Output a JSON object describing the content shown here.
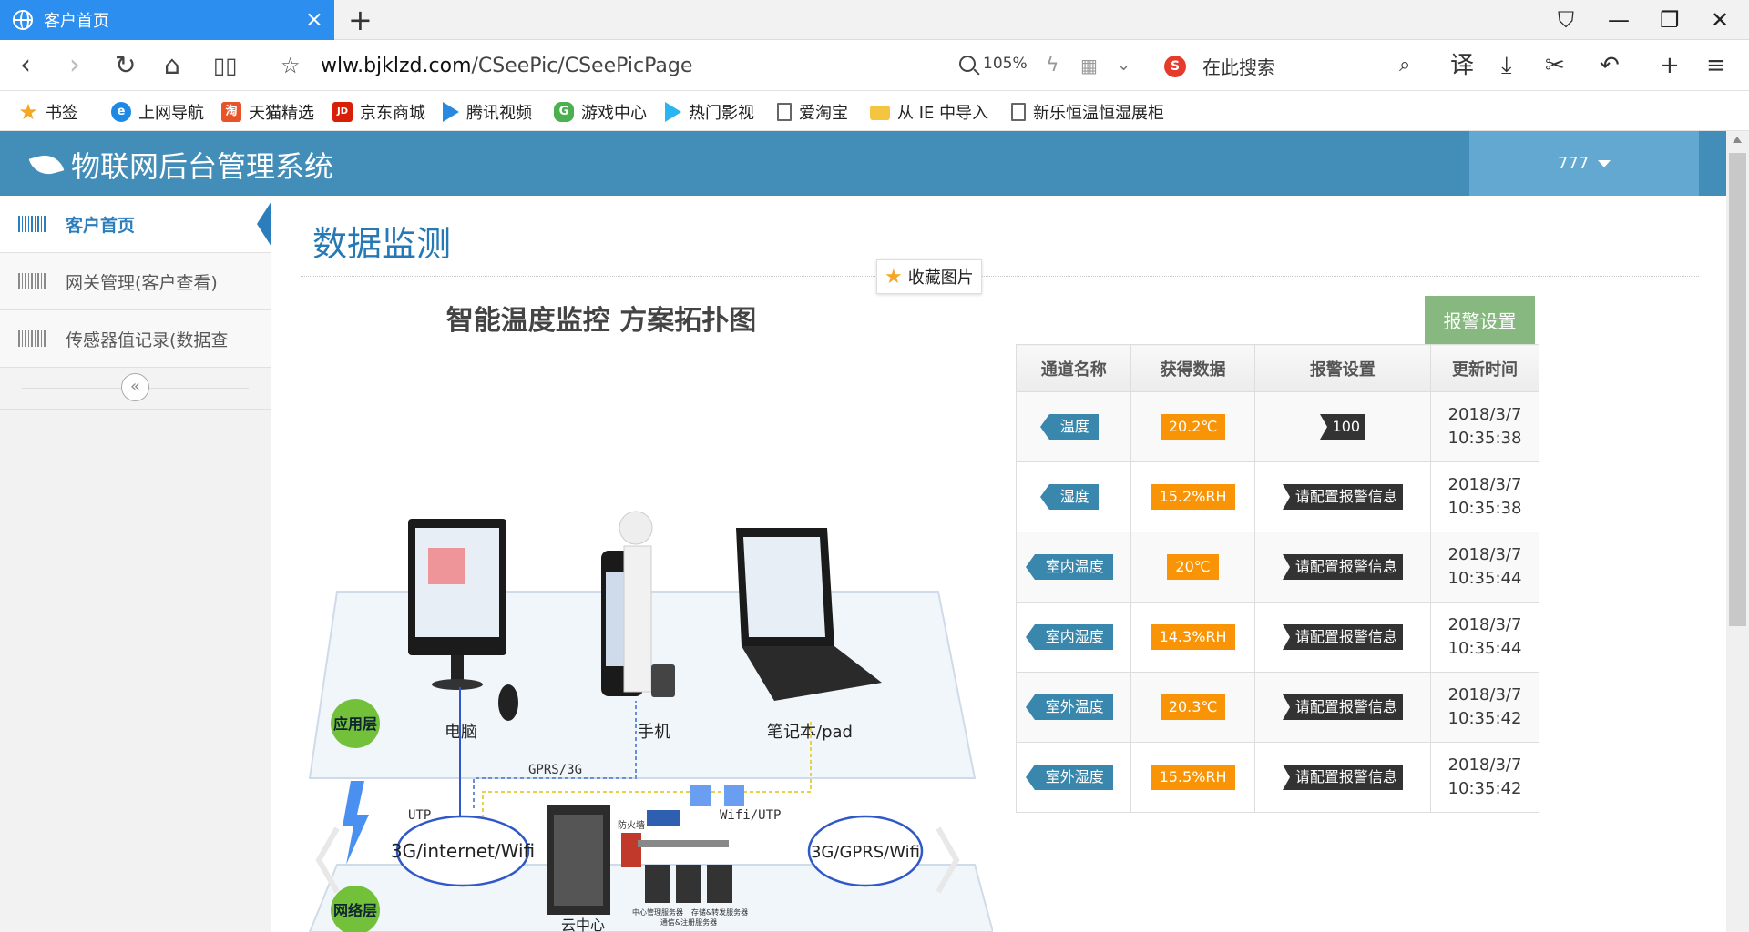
{
  "browser": {
    "tab_title": "客户首页",
    "url_domain": "wlw.bjklzd.com",
    "url_path": "/CSeePic/CSeePicPage",
    "zoom": "105%",
    "search_placeholder": "在此搜索",
    "search_engine_icon": "S",
    "translate_label": "译"
  },
  "bookmarks": [
    {
      "label": "书签",
      "icon": "star-icon",
      "color": "#f5a623"
    },
    {
      "label": "上网导航",
      "icon": "ie-icon",
      "color": "#1e88e5",
      "glyph": "e"
    },
    {
      "label": "天猫精选",
      "icon": "tmall-icon",
      "color": "#e8542a",
      "glyph": "淘"
    },
    {
      "label": "京东商城",
      "icon": "jd-icon",
      "color": "#d81e06",
      "glyph": "JD"
    },
    {
      "label": "腾讯视频",
      "icon": "video-icon",
      "color": "#2a88e0"
    },
    {
      "label": "游戏中心",
      "icon": "gamepad-icon",
      "color": "#4caf50",
      "glyph": "G"
    },
    {
      "label": "热门影视",
      "icon": "play-icon",
      "color": "#2ab5f0"
    },
    {
      "label": "爱淘宝",
      "icon": "document-icon"
    },
    {
      "label": "从 IE 中导入",
      "icon": "folder-icon"
    },
    {
      "label": "新乐恒温恒湿展柜",
      "icon": "document-icon"
    }
  ],
  "app": {
    "title": "物联网后台管理系统",
    "user": "777"
  },
  "sidebar": {
    "items": [
      {
        "label": "客户首页",
        "active": true
      },
      {
        "label": "网关管理(客户查看)",
        "active": false
      },
      {
        "label": "传感器值记录(数据查",
        "active": false
      }
    ],
    "collapse_glyph": "«"
  },
  "main": {
    "page_title": "数据监测",
    "favorite_label": "收藏图片",
    "alarm_button": "报警设置",
    "diagram": {
      "title": "智能温度监控 方案拓扑图",
      "labels": {
        "app_layer": "应用层",
        "net_layer": "网络层",
        "pc": "电脑",
        "phone": "手机",
        "laptop": "笔记本/pad",
        "utp": "UTP",
        "gprs": "GPRS/3G",
        "wifi_utp": "Wifi/UTP",
        "cloud_left": "3G/internet/Wifi",
        "cloud_right": "3G/GPRS/Wifi",
        "firewall": "防火墙",
        "cloud_center": "云中心",
        "srv1": "中心管理服务器",
        "srv2": "通信&注册服务器",
        "srv3": "存储&转发服务器"
      }
    },
    "table": {
      "headers": [
        "通道名称",
        "获得数据",
        "报警设置",
        "更新时间"
      ],
      "rows": [
        {
          "channel": "温度",
          "value": "20.2℃",
          "alarm": "100",
          "date": "2018/3/7",
          "time": "10:35:38"
        },
        {
          "channel": "湿度",
          "value": "15.2%RH",
          "alarm": "请配置报警信息",
          "date": "2018/3/7",
          "time": "10:35:38"
        },
        {
          "channel": "室内温度",
          "value": "20℃",
          "alarm": "请配置报警信息",
          "date": "2018/3/7",
          "time": "10:35:44"
        },
        {
          "channel": "室内湿度",
          "value": "14.3%RH",
          "alarm": "请配置报警信息",
          "date": "2018/3/7",
          "time": "10:35:44"
        },
        {
          "channel": "室外温度",
          "value": "20.3℃",
          "alarm": "请配置报警信息",
          "date": "2018/3/7",
          "time": "10:35:42"
        },
        {
          "channel": "室外湿度",
          "value": "15.5%RH",
          "alarm": "请配置报警信息",
          "date": "2018/3/7",
          "time": "10:35:42"
        }
      ]
    }
  },
  "colors": {
    "header_bg": "#438eb9",
    "user_bg": "#62a8d1",
    "accent": "#2b7dbc",
    "alarm_btn": "#87b87f",
    "value_badge": "#f89406",
    "channel_badge": "#3a87ad",
    "alarm_badge": "#333333"
  }
}
